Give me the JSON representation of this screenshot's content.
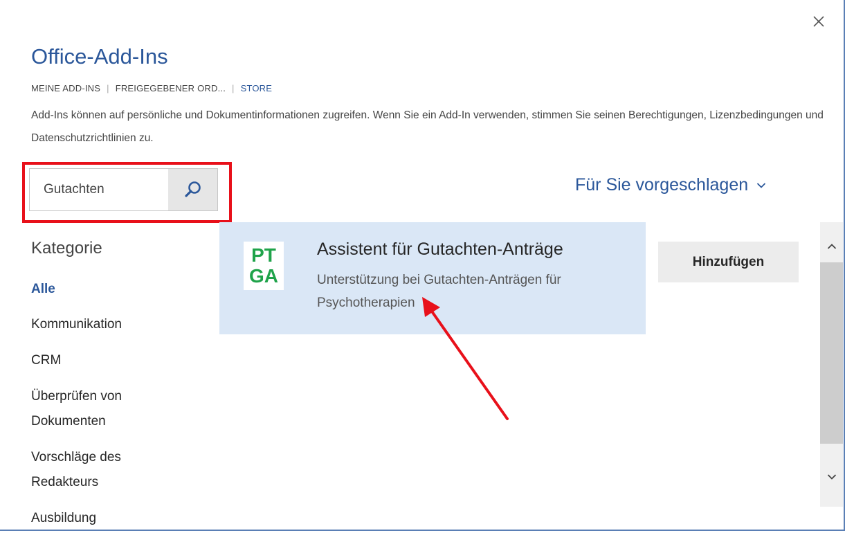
{
  "dialog": {
    "title": "Office-Add-Ins",
    "close_icon": "close-icon"
  },
  "nav": {
    "items": [
      {
        "label": "MEINE ADD-INS"
      },
      {
        "label": "FREIGEGEBENER ORD..."
      },
      {
        "label": "STORE"
      }
    ]
  },
  "description": "Add-Ins können auf persönliche und Dokumentinformationen zugreifen. Wenn Sie ein Add-In verwenden, stimmen Sie seinen Berechtigungen, Lizenzbedingungen und Datenschutzrichtlinien zu.",
  "search": {
    "value": "Gutachten",
    "icon": "search-icon"
  },
  "suggest": {
    "label": "Für Sie vorgeschlagen",
    "icon": "chevron-down-icon"
  },
  "category": {
    "title": "Kategorie",
    "items": [
      {
        "label": "Alle"
      },
      {
        "label": "Kommunikation"
      },
      {
        "label": "CRM"
      },
      {
        "label": "Überprüfen von Dokumenten"
      },
      {
        "label": "Vorschläge des Redakteurs"
      },
      {
        "label": "Ausbildung"
      }
    ]
  },
  "result": {
    "logo_line1": "PT",
    "logo_line2": "GA",
    "title": "Assistent für Gutachten-Anträge",
    "description": "Unterstützung bei Gutachten-Anträgen für Psychotherapien",
    "add_label": "Hinzufügen"
  },
  "colors": {
    "accent": "#2b579a",
    "highlight_box": "#e8101a",
    "annotation_arrow": "#e8101a",
    "card_background": "#dae7f6",
    "logo_text": "#1fa34a"
  }
}
